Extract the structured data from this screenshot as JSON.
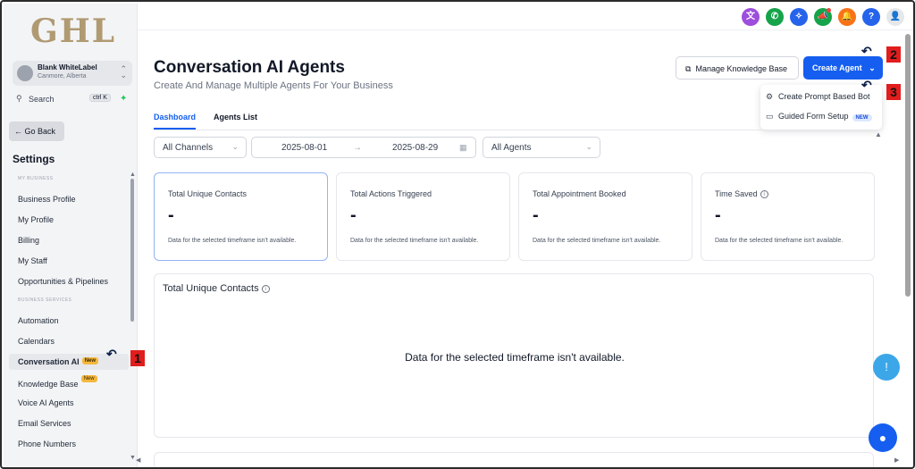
{
  "sidebar": {
    "logo": "GHL",
    "account": {
      "name": "Blank WhiteLabel",
      "location": "Canmore, Alberta"
    },
    "search": {
      "label": "Search",
      "shortcut": "ctrl K"
    },
    "go_back": "Go Back",
    "settings_title": "Settings",
    "group_my_business": "MY BUSINESS",
    "group_business_services": "BUSINESS SERVICES",
    "items_my_business": [
      "Business Profile",
      "My Profile",
      "Billing",
      "My Staff",
      "Opportunities & Pipelines"
    ],
    "items_services": [
      "Automation",
      "Calendars",
      "Conversation AI",
      "Knowledge Base",
      "Voice AI Agents",
      "Email Services",
      "Phone Numbers"
    ],
    "new_badge": "New"
  },
  "header": {
    "title": "Conversation AI Agents",
    "subtitle": "Create And Manage Multiple Agents For Your Business",
    "manage_kb_label": "Manage Knowledge Base",
    "create_agent_label": "Create Agent"
  },
  "create_menu": {
    "items": [
      "Create Prompt Based Bot",
      "Guided Form Setup"
    ],
    "new_pill": "NEW"
  },
  "tabs": [
    "Dashboard",
    "Agents List"
  ],
  "filters": {
    "channels": "All Channels",
    "date_from": "2025-08-01",
    "date_to": "2025-08-29",
    "agents": "All Agents"
  },
  "stats": [
    {
      "title": "Total Unique Contacts",
      "value": "-",
      "note": "Data for the selected timeframe isn't available."
    },
    {
      "title": "Total Actions Triggered",
      "value": "-",
      "note": "Data for the selected timeframe isn't available."
    },
    {
      "title": "Total Appointment Booked",
      "value": "-",
      "note": "Data for the selected timeframe isn't available."
    },
    {
      "title": "Time Saved",
      "value": "-",
      "note": "Data for the selected timeframe isn't available."
    }
  ],
  "chart_panel": {
    "title": "Total Unique Contacts",
    "empty_message": "Data for the selected timeframe isn't available."
  },
  "annotations": [
    "1",
    "2",
    "3"
  ],
  "colors": {
    "primary": "#155eef",
    "badge": "#f5b83d",
    "annotation": "#e11d1d"
  }
}
